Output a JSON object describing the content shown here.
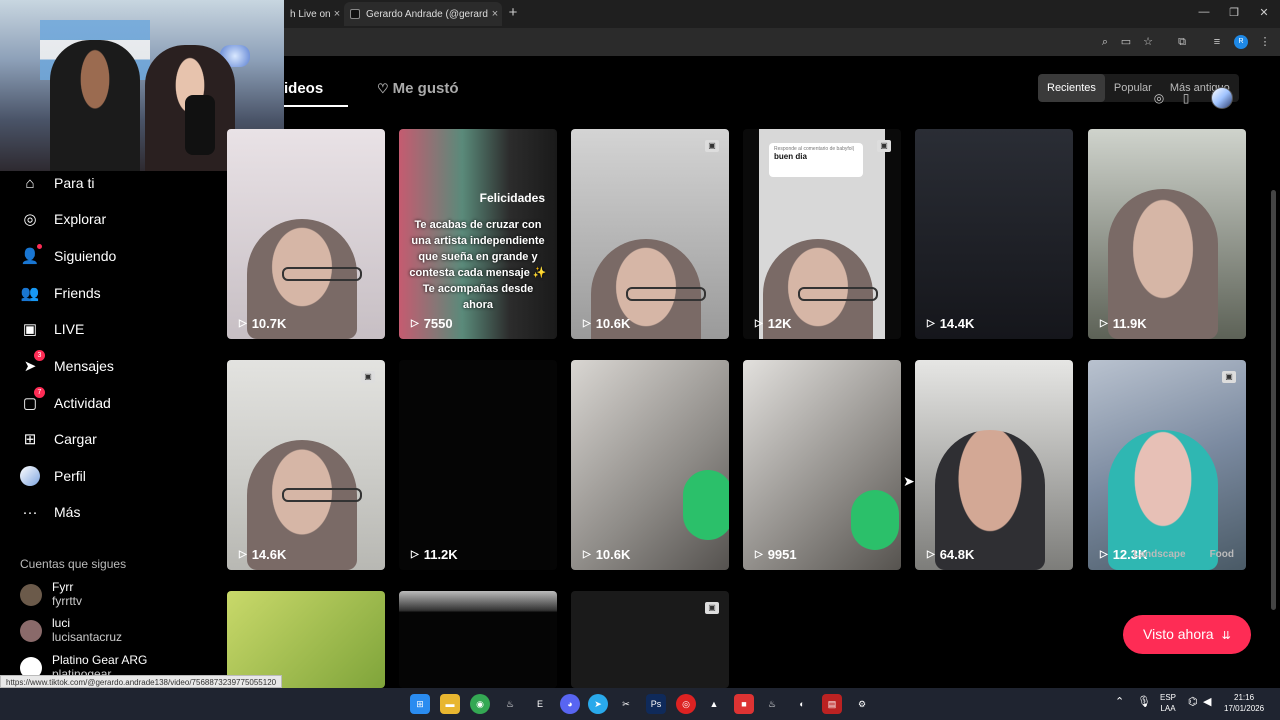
{
  "browser": {
    "tabs": [
      {
        "title": "h Live on",
        "close": "×"
      },
      {
        "title": "Gerardo Andrade (@gerardo.an",
        "close": "×"
      }
    ],
    "new_tab": "+",
    "window_controls": [
      "—",
      "❐",
      "✕"
    ]
  },
  "profile": {
    "tabs": {
      "videos": "ideos",
      "liked": "Me gustó"
    },
    "sort": {
      "recent": "Recientes",
      "popular": "Popular",
      "oldest": "Más antiguo"
    }
  },
  "sidebar": {
    "items": [
      {
        "label": "Para ti",
        "icon": "home-icon"
      },
      {
        "label": "Explorar",
        "icon": "compass-icon"
      },
      {
        "label": "Siguiendo",
        "icon": "following-icon"
      },
      {
        "label": "Friends",
        "icon": "friends-icon"
      },
      {
        "label": "LIVE",
        "icon": "live-icon"
      },
      {
        "label": "Mensajes",
        "icon": "messages-icon",
        "badge": "3"
      },
      {
        "label": "Actividad",
        "icon": "activity-icon",
        "badge": "7"
      },
      {
        "label": "Cargar",
        "icon": "upload-icon"
      },
      {
        "label": "Perfil",
        "icon": "profile-avatar"
      },
      {
        "label": "Más",
        "icon": "more-icon"
      }
    ],
    "following_title": "Cuentas que sigues",
    "accounts": [
      {
        "name": "Fyrr",
        "user": "fyrrttv"
      },
      {
        "name": "luci",
        "user": "lucisantacruz"
      },
      {
        "name": "Platino Gear ARG",
        "user": "platinogear"
      }
    ]
  },
  "videos": [
    {
      "views": "10.7K"
    },
    {
      "views": "7550",
      "title": "Felicidades",
      "caption": "Te acabas de cruzar con una artista independiente que sueña en grande y contesta cada mensaje ✨ Te acompañas desde ahora"
    },
    {
      "views": "10.6K"
    },
    {
      "views": "12K",
      "bubble_small": "Responde al comentario de babyfol|",
      "bubble_text": "buen dia"
    },
    {
      "views": "14.4K"
    },
    {
      "views": "11.9K"
    },
    {
      "views": "14.6K"
    },
    {
      "views": "11.2K"
    },
    {
      "views": "10.6K"
    },
    {
      "views": "9951"
    },
    {
      "views": "64.8K"
    },
    {
      "views": "12.3K",
      "tags": [
        "Landscape",
        "Food"
      ]
    },
    {
      "views": ""
    },
    {
      "views": ""
    },
    {
      "views": ""
    }
  ],
  "visto_ahora": "Visto ahora",
  "status_url": "https://www.tiktok.com/@gerardo.andrade138/video/7568873239775055120",
  "taskbar": {
    "lang": [
      "ESP",
      "LAA"
    ],
    "time": "21:16",
    "date": "17/01/2026"
  },
  "colors": {
    "accent": "#fe2c55"
  }
}
